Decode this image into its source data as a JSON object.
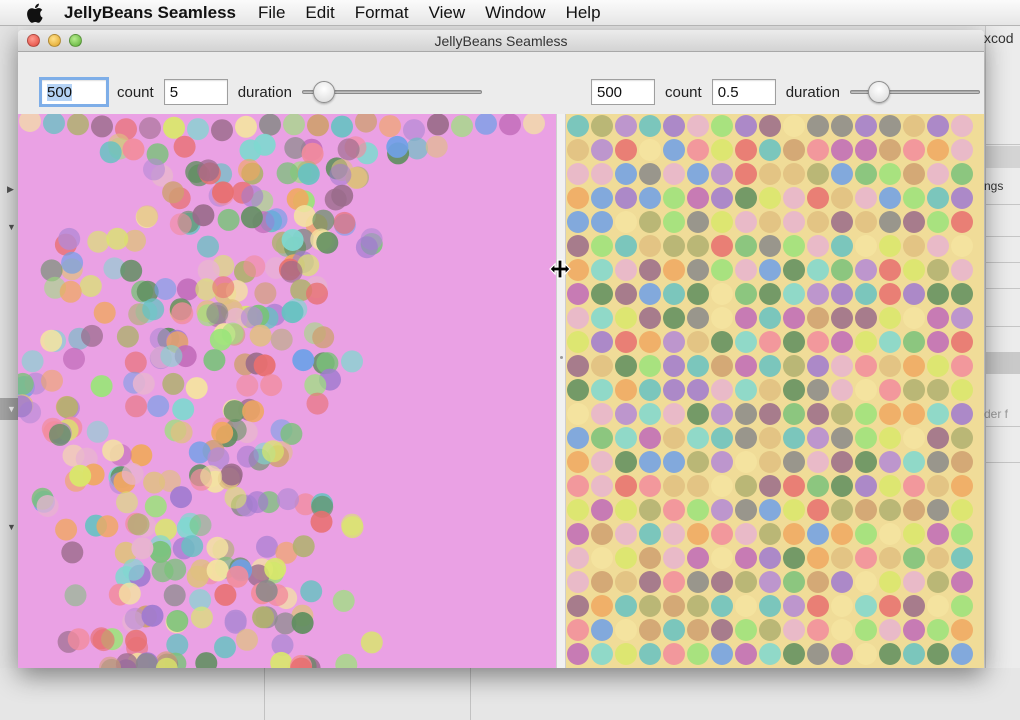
{
  "menubar": {
    "app_name": "JellyBeans Seamless",
    "items": [
      "File",
      "Edit",
      "Format",
      "View",
      "Window",
      "Help"
    ]
  },
  "window": {
    "title": "JellyBeans Seamless",
    "left_panel": {
      "count_value": "500",
      "count_label": "count",
      "duration_value": "5",
      "duration_label": "duration",
      "slider_level": 0.07
    },
    "right_panel": {
      "count_value": "500",
      "count_label": "count",
      "duration_value": "0.5",
      "duration_label": "duration",
      "slider_level": 0.2
    }
  },
  "background_app": {
    "fragments": [
      "xcod",
      "ngs",
      "rder f"
    ]
  },
  "colors": {
    "left_pane_bg": "#eaa1e4",
    "right_pane_bg": "#f0dc98",
    "focus_ring": "#7eaee8"
  },
  "icons": [
    "apple-icon",
    "close-icon",
    "minimize-icon",
    "zoom-icon",
    "resize-cursor-icon",
    "disclosure-triangle-icon"
  ]
}
